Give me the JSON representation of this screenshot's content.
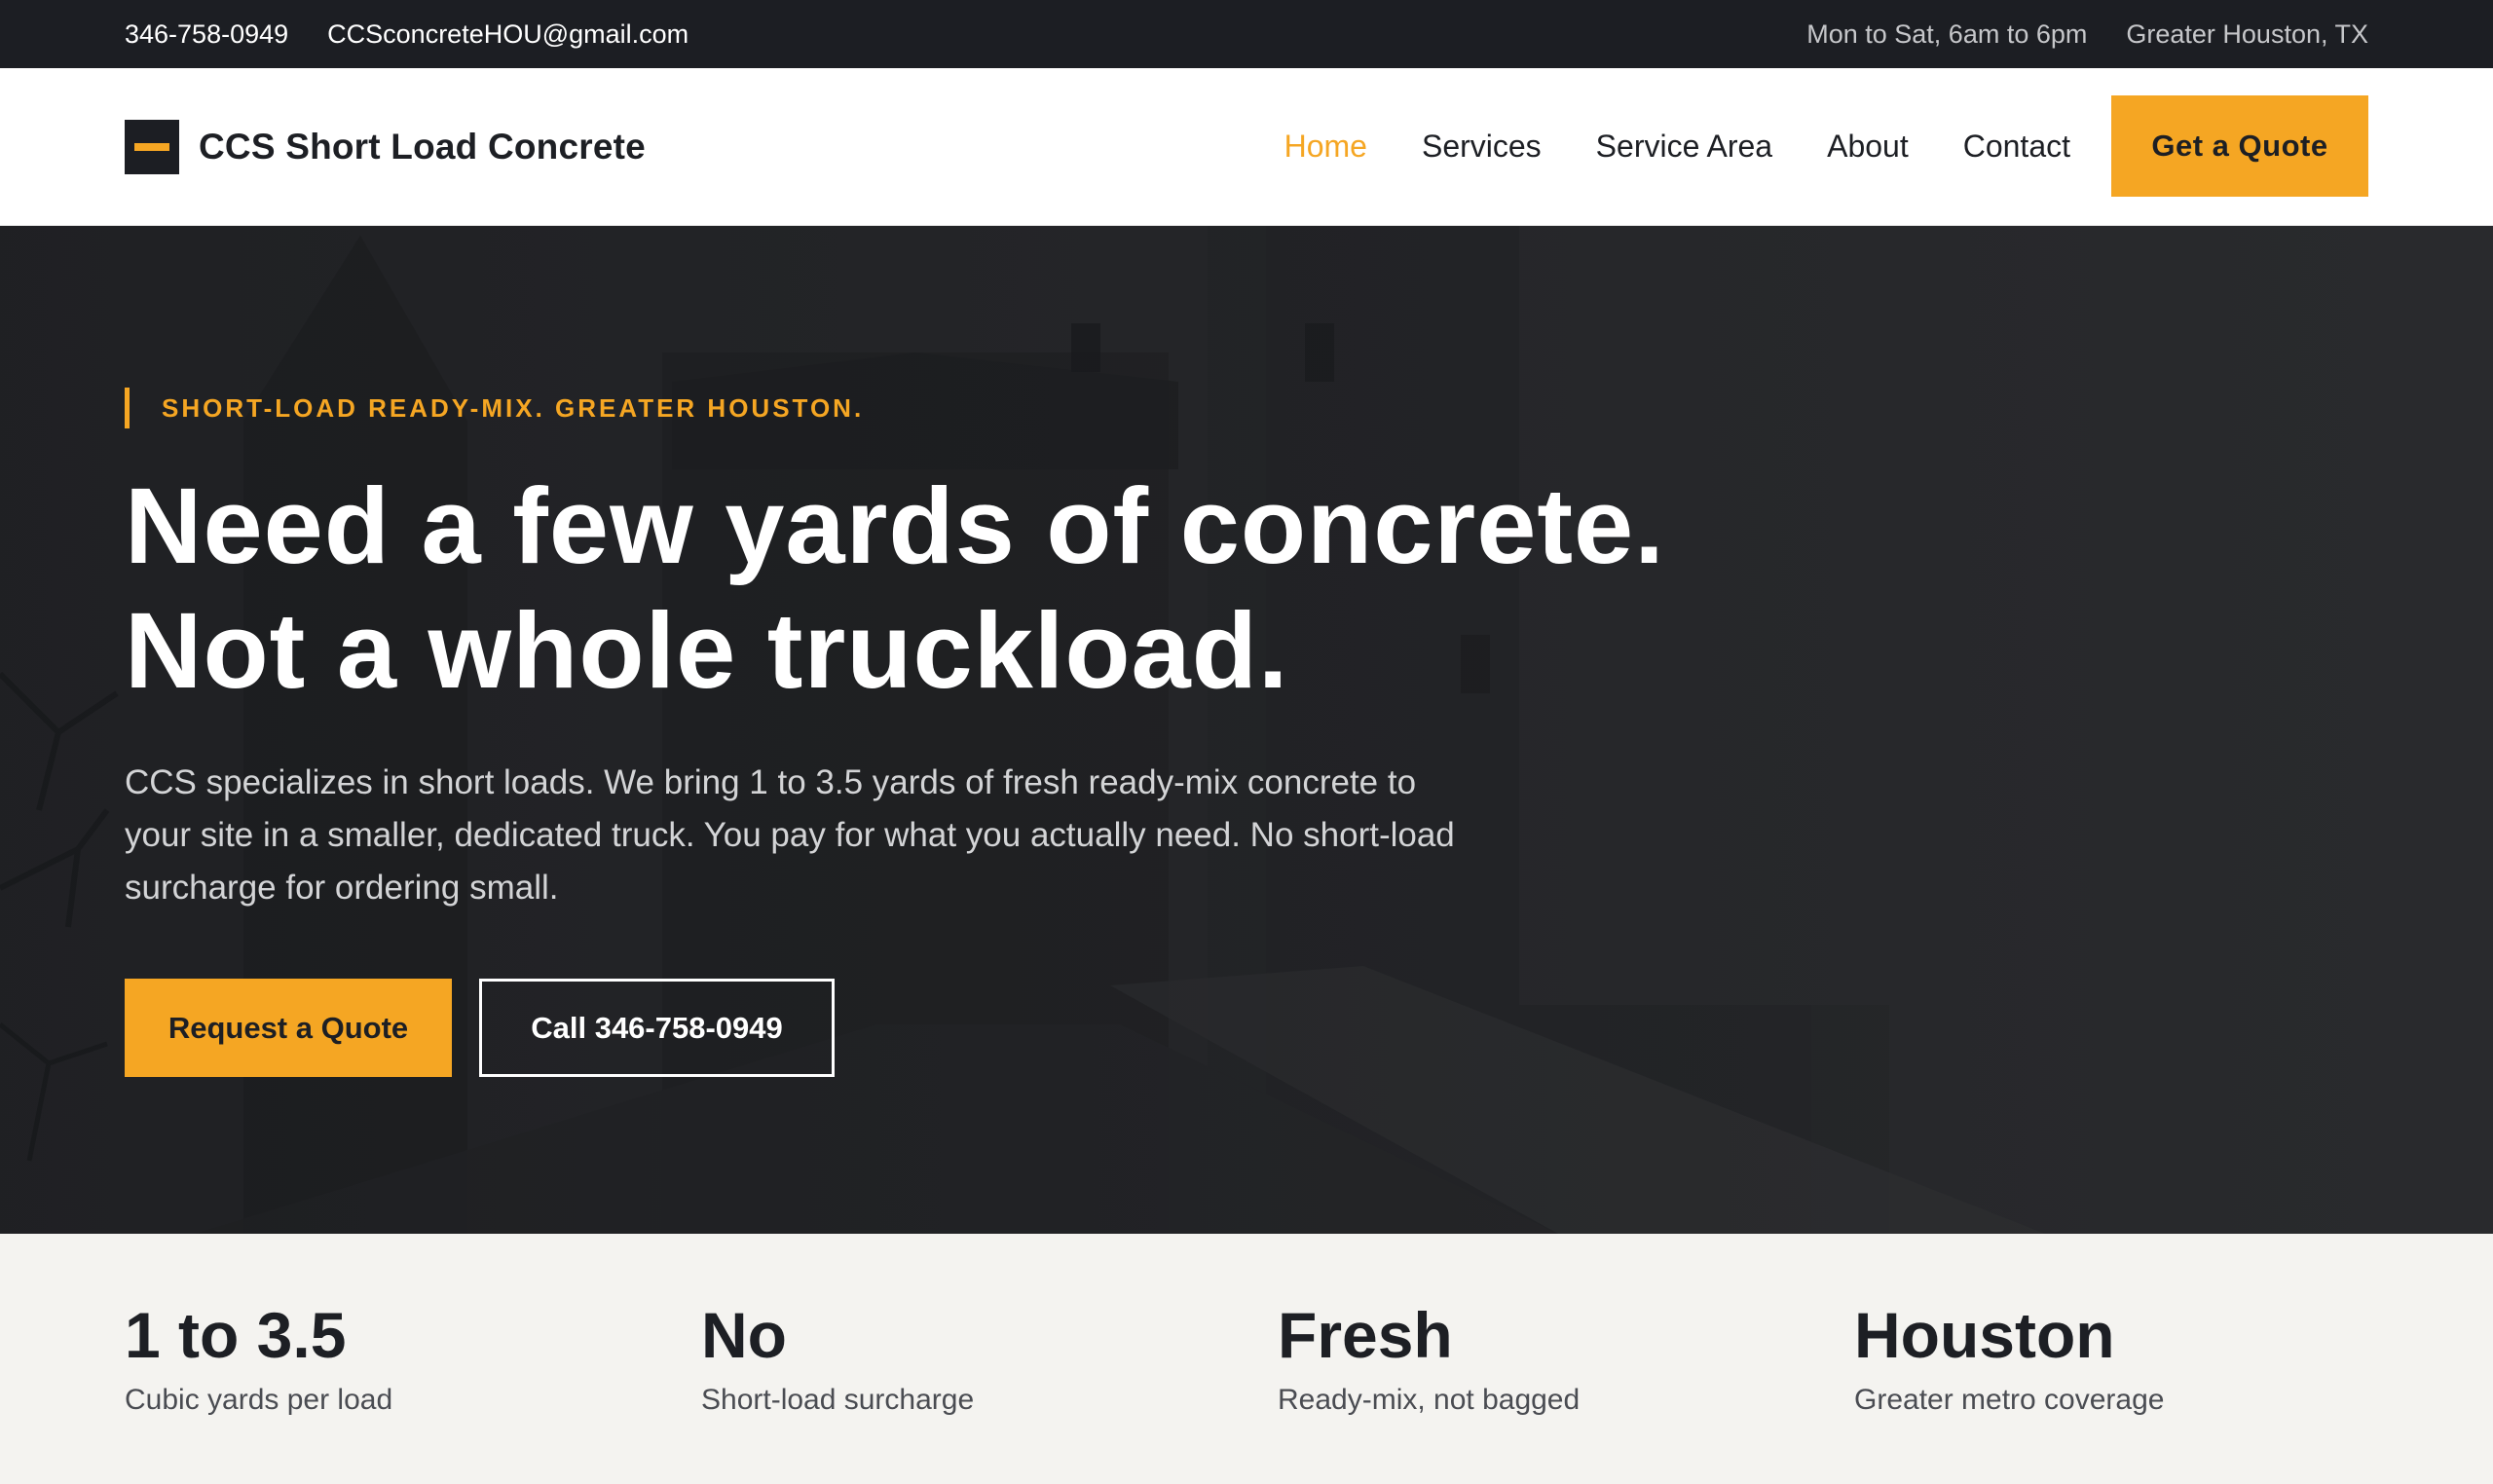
{
  "topbar": {
    "phone": "346-758-0949",
    "email": "CCSconcreteHOU@gmail.com",
    "hours": "Mon to Sat, 6am to 6pm",
    "location": "Greater Houston, TX"
  },
  "header": {
    "brand": "CCS Short Load Concrete",
    "nav": [
      {
        "label": "Home",
        "active": true
      },
      {
        "label": "Services"
      },
      {
        "label": "Service Area"
      },
      {
        "label": "About"
      },
      {
        "label": "Contact"
      }
    ],
    "quote_button": "Get a Quote"
  },
  "hero": {
    "eyebrow": "SHORT-LOAD READY-MIX. GREATER HOUSTON.",
    "headline_line1": "Need a few yards of concrete.",
    "headline_line2": "Not a whole truckload.",
    "lead": "CCS specializes in short loads. We bring 1 to 3.5 yards of fresh ready-mix concrete to your site in a smaller, dedicated truck. You pay for what you actually need. No short-load surcharge for ordering small.",
    "primary_cta": "Request a Quote",
    "secondary_cta": "Call 346-758-0949"
  },
  "stats": [
    {
      "value": "1 to 3.5",
      "label": "Cubic yards per load"
    },
    {
      "value": "No",
      "label": "Short-load surcharge"
    },
    {
      "value": "Fresh",
      "label": "Ready-mix, not bagged"
    },
    {
      "value": "Houston",
      "label": "Greater metro coverage"
    }
  ],
  "colors": {
    "accent": "#f5a623",
    "dark": "#1c1e23",
    "stats_bg": "#f4f3f0"
  },
  "icons": {
    "logo": "concrete-block-logo-icon"
  }
}
